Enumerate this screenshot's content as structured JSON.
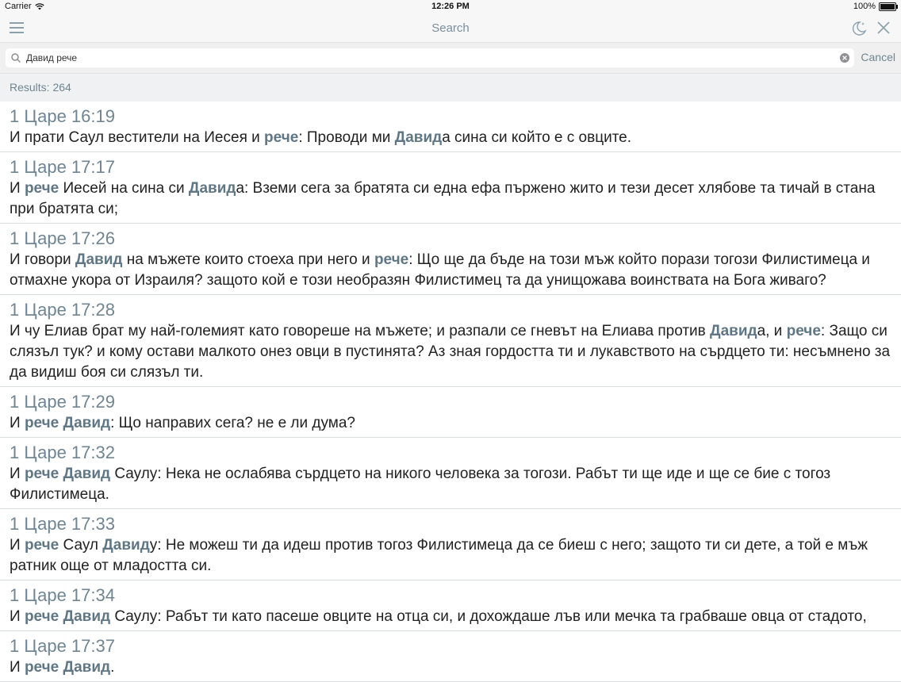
{
  "status": {
    "carrier": "Carrier",
    "time": "12:26 PM",
    "battery": "100%"
  },
  "nav": {
    "title": "Search"
  },
  "search": {
    "value": "Давид рече",
    "cancel": "Cancel"
  },
  "results": {
    "count_label": "Results: 264",
    "items": [
      {
        "ref": "1 Царе 16:19",
        "segments": [
          {
            "t": "И прати Саул вестители на Иесея и "
          },
          {
            "t": "рече",
            "hl": true
          },
          {
            "t": ": Проводи ми "
          },
          {
            "t": "Давид",
            "hl": true
          },
          {
            "t": "а сина си който е с овците."
          }
        ]
      },
      {
        "ref": "1 Царе 17:17",
        "segments": [
          {
            "t": "И "
          },
          {
            "t": "рече",
            "hl": true
          },
          {
            "t": " Иесей на сина си "
          },
          {
            "t": "Давид",
            "hl": true
          },
          {
            "t": "а: Вземи сега за братята си една ефа пържено жито и тези десет хлябове та тичай в стана при братята си;"
          }
        ]
      },
      {
        "ref": "1 Царе 17:26",
        "segments": [
          {
            "t": "И говори "
          },
          {
            "t": "Давид",
            "hl": true
          },
          {
            "t": " на мъжете които стоеха при него и "
          },
          {
            "t": "рече",
            "hl": true
          },
          {
            "t": ": Що ще да бъде на този мъж който порази тогози Филистимеца и отмахне укора от Израиля? защото кой е този необразян Филистимец та да унищожава воинствата на Бога живаго?"
          }
        ]
      },
      {
        "ref": "1 Царе 17:28",
        "segments": [
          {
            "t": "И чу Елиав брат му най-големият като говореше на мъжете; и разпали се гневът на Елиава против "
          },
          {
            "t": "Давид",
            "hl": true
          },
          {
            "t": "а, и "
          },
          {
            "t": "рече",
            "hl": true
          },
          {
            "t": ": Защо си слязъл тук? и кому остави малкото онез овци в пустинята? Аз зная гордостта ти и лукавството на сърдцето ти: несъмнено за да видиш боя си слязъл ти."
          }
        ]
      },
      {
        "ref": "1 Царе 17:29",
        "segments": [
          {
            "t": "И "
          },
          {
            "t": "рече",
            "hl": true
          },
          {
            "t": " "
          },
          {
            "t": "Давид",
            "hl": true
          },
          {
            "t": ": Що направих сега? не е ли дума?"
          }
        ]
      },
      {
        "ref": "1 Царе 17:32",
        "segments": [
          {
            "t": "И "
          },
          {
            "t": "рече",
            "hl": true
          },
          {
            "t": " "
          },
          {
            "t": "Давид",
            "hl": true
          },
          {
            "t": " Саулу: Нека не ослабява сърдцето на никого человека за тогози. Рабът ти ще иде и ще се бие с тогоз Филистимеца."
          }
        ]
      },
      {
        "ref": "1 Царе 17:33",
        "segments": [
          {
            "t": "И "
          },
          {
            "t": "рече",
            "hl": true
          },
          {
            "t": " Саул "
          },
          {
            "t": "Давид",
            "hl": true
          },
          {
            "t": "у: Не можеш ти да идеш против тогоз Филистимеца да се биеш с него; защото ти си дете, а той е мъж ратник още от младостта си."
          }
        ]
      },
      {
        "ref": "1 Царе 17:34",
        "segments": [
          {
            "t": "И "
          },
          {
            "t": "рече",
            "hl": true
          },
          {
            "t": " "
          },
          {
            "t": "Давид",
            "hl": true
          },
          {
            "t": " Саулу: Рабът ти като пасеше овците на отца си, и дохождаше лъв или мечка та грабваше овца от стадото,"
          }
        ]
      },
      {
        "ref": "1 Царе 17:37",
        "segments": [
          {
            "t": "И "
          },
          {
            "t": "рече",
            "hl": true
          },
          {
            "t": " "
          },
          {
            "t": "Давид",
            "hl": true
          },
          {
            "t": "."
          }
        ]
      }
    ]
  }
}
